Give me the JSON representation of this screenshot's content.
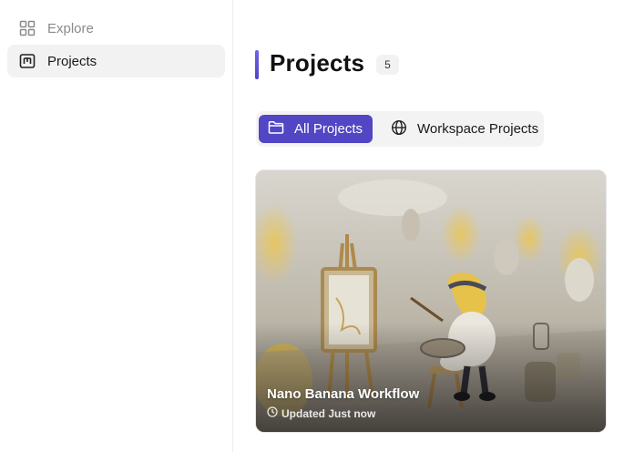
{
  "sidebar": {
    "items": [
      {
        "label": "Explore",
        "icon": "grid-icon",
        "active": false
      },
      {
        "label": "Projects",
        "icon": "projects-icon",
        "active": true
      }
    ]
  },
  "main": {
    "title": "Projects",
    "count": "5",
    "tabs": [
      {
        "label": "All Projects",
        "icon": "folder-icon",
        "active": true
      },
      {
        "label": "Workspace Projects",
        "icon": "globe-icon",
        "active": false
      }
    ],
    "projects": [
      {
        "title": "Nano Banana Workflow",
        "updated": "Updated Just now"
      }
    ]
  },
  "colors": {
    "accent": "#5246c4",
    "title_bar": "#6f63e8",
    "active_nav_bg": "#f2f2f2"
  }
}
